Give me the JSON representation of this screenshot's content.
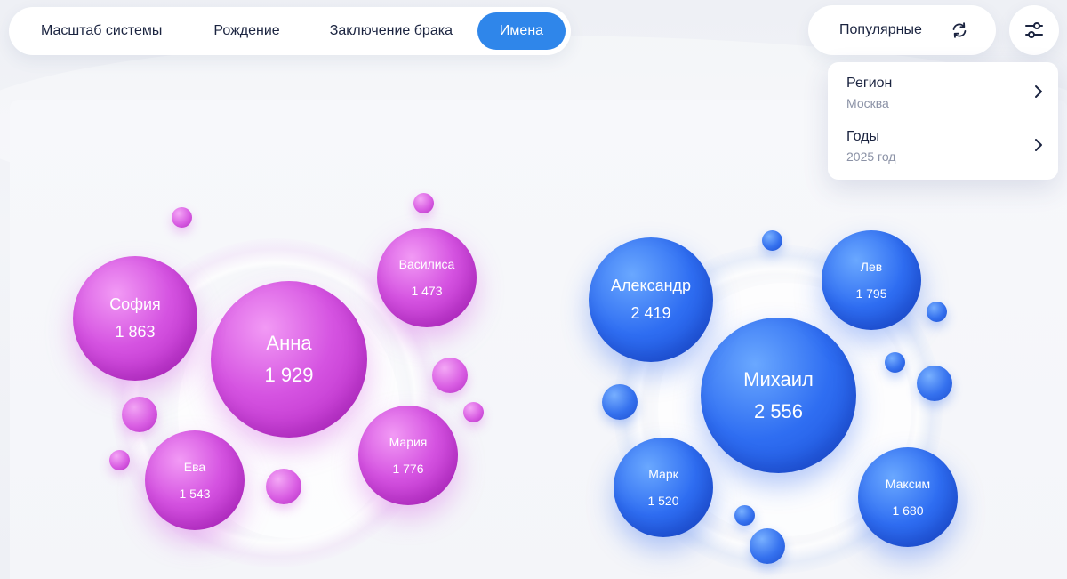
{
  "tabs": [
    {
      "label": "Масштаб системы",
      "active": false
    },
    {
      "label": "Рождение",
      "active": false
    },
    {
      "label": "Заключение брака",
      "active": false
    },
    {
      "label": "Имена",
      "active": true
    }
  ],
  "controls": {
    "popular_label": "Популярные",
    "refresh_icon": "refresh-icon",
    "filter_icon": "sliders-icon"
  },
  "filters": {
    "region": {
      "title": "Регион",
      "value": "Москва"
    },
    "years": {
      "title": "Годы",
      "value": "2025 год"
    }
  },
  "colors": {
    "accent": "#2f86ea",
    "female": "#d553e1",
    "male": "#2f6ef2"
  },
  "names": {
    "female": [
      {
        "name": "Анна",
        "count": "1 929"
      },
      {
        "name": "София",
        "count": "1 863"
      },
      {
        "name": "Мария",
        "count": "1 776"
      },
      {
        "name": "Ева",
        "count": "1 543"
      },
      {
        "name": "Василиса",
        "count": "1 473"
      }
    ],
    "male": [
      {
        "name": "Михаил",
        "count": "2 556"
      },
      {
        "name": "Александр",
        "count": "2 419"
      },
      {
        "name": "Лев",
        "count": "1 795"
      },
      {
        "name": "Максим",
        "count": "1 680"
      },
      {
        "name": "Марк",
        "count": "1 520"
      }
    ]
  }
}
